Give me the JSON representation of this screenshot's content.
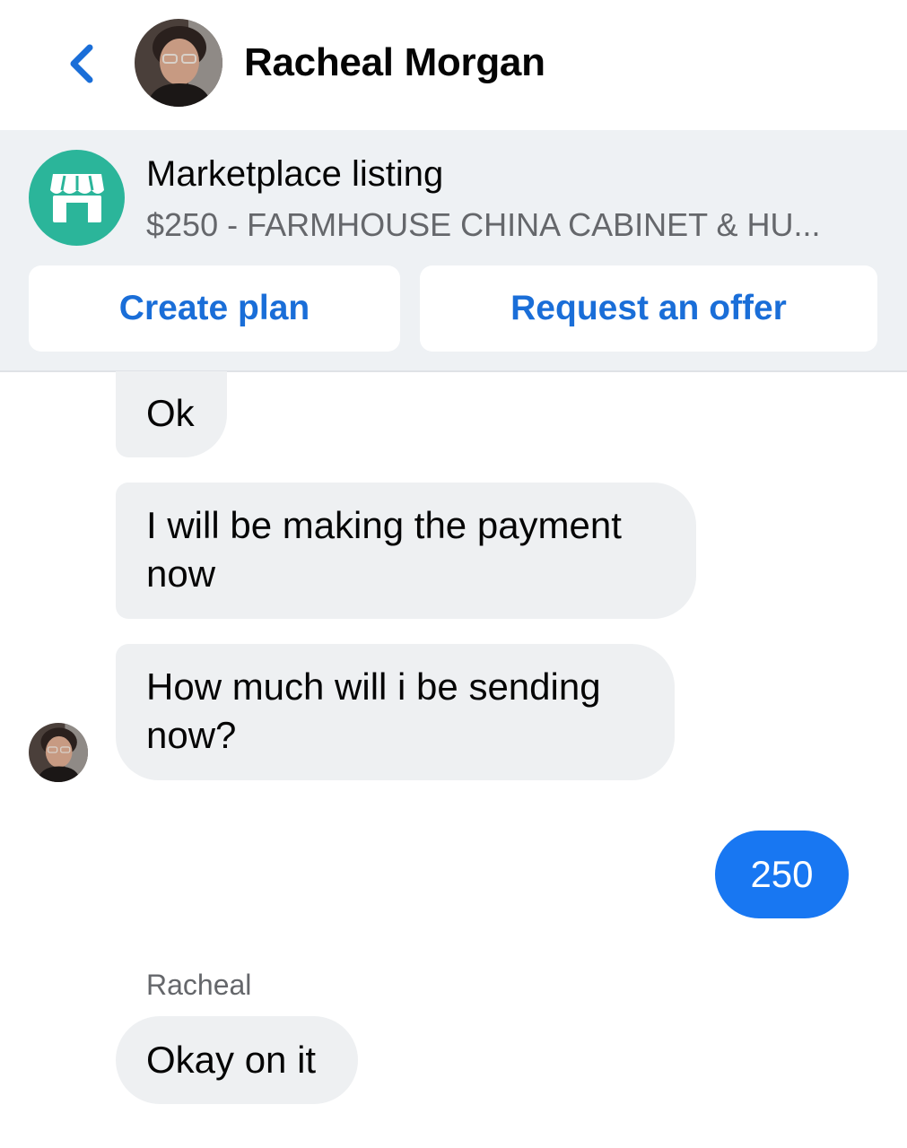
{
  "header": {
    "contact_name": "Racheal Morgan",
    "back_icon": "chevron-left-icon",
    "accent_color": "#1a6ed8"
  },
  "banner": {
    "icon": "storefront-icon",
    "icon_color": "#2bb59a",
    "title": "Marketplace listing",
    "subtitle": "$250 - FARMHOUSE CHINA CABINET & HU...",
    "buttons": {
      "create_plan": "Create plan",
      "request_offer": "Request an offer"
    }
  },
  "messages": [
    {
      "from": "contact",
      "lines": [
        "Ok"
      ]
    },
    {
      "from": "contact",
      "lines": [
        "I will be making the payment",
        "now"
      ]
    },
    {
      "from": "contact",
      "lines": [
        "How much will i be sending",
        "now?"
      ]
    },
    {
      "from": "me",
      "lines": [
        "250"
      ]
    },
    {
      "from": "contact",
      "sender": "Racheal",
      "lines": [
        "Okay on it"
      ]
    }
  ],
  "colors": {
    "incoming_bubble": "#eef0f2",
    "outgoing_bubble": "#1877f2"
  }
}
